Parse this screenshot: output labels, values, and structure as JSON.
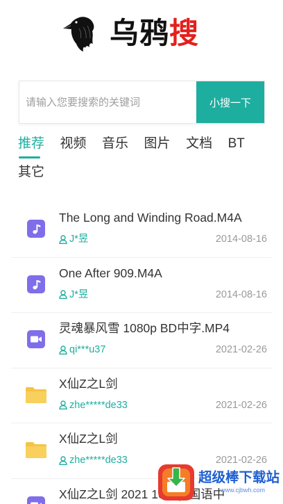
{
  "header": {
    "logo_icon": "crow-logo-icon",
    "brand_prefix": "乌鸦",
    "brand_suffix": "搜"
  },
  "search": {
    "placeholder": "请输入您要搜索的关键词",
    "value": "",
    "button_label": "小搜一下"
  },
  "tabs": [
    {
      "label": "推荐",
      "active": true
    },
    {
      "label": "视频",
      "active": false
    },
    {
      "label": "音乐",
      "active": false
    },
    {
      "label": "图片",
      "active": false
    },
    {
      "label": "文档",
      "active": false
    },
    {
      "label": "BT",
      "active": false
    },
    {
      "label": "其它",
      "active": false
    }
  ],
  "results": [
    {
      "icon": "music-file-icon",
      "title": "The Long and Winding Road.M4A",
      "user": "J*昱",
      "date": "2014-08-16"
    },
    {
      "icon": "music-file-icon",
      "title": "One After 909.M4A",
      "user": "J*昱",
      "date": "2014-08-16"
    },
    {
      "icon": "video-file-icon",
      "title": "灵魂暴风雪 1080p BD中字.MP4",
      "user": "qi***u37",
      "date": "2021-02-26"
    },
    {
      "icon": "folder-icon",
      "title": "X仙Z之L剑",
      "user": "zhe*****de33",
      "date": "2021-02-26"
    },
    {
      "icon": "folder-icon",
      "title": "X仙Z之L剑",
      "user": "zhe*****de33",
      "date": "2021-02-26"
    },
    {
      "icon": "video-file-icon",
      "title": "X仙Z之L剑 2021 1080p 国语中"
    }
  ],
  "watermark": {
    "icon": "download-site-logo-icon",
    "title": "超级棒下载站",
    "url": "www.cjbwh.com"
  },
  "colors": {
    "accent": "#1eae9f",
    "brand_red": "#e3201c",
    "media_icon": "#7f6ee9",
    "folder_icon": "#f6c344",
    "text": "#333333",
    "muted": "#999999",
    "watermark_blue": "#1f5fd1"
  }
}
